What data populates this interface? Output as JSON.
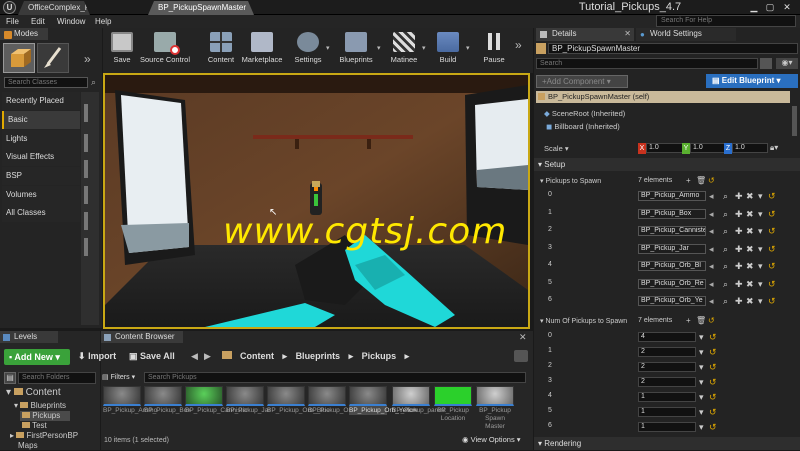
{
  "titlebar": {
    "logo": "U",
    "tabs": [
      "OfficeComplex_P",
      "BP_PickupSpawnMaster"
    ],
    "window_title": "Tutorial_Pickups_4.7"
  },
  "menu": {
    "items": [
      "File",
      "Edit",
      "Window",
      "Help"
    ],
    "help_search_placeholder": "Search For Help"
  },
  "modes": {
    "tab_label": "Modes",
    "search_placeholder": "Search Classes",
    "categories": [
      "Recently Placed",
      "Basic",
      "Lights",
      "Visual Effects",
      "BSP",
      "Volumes",
      "All Classes"
    ],
    "selected_category": "Basic"
  },
  "toolbar": {
    "buttons": [
      "Save",
      "Source Control",
      "Content",
      "Marketplace",
      "Settings",
      "Blueprints",
      "Matinee",
      "Build",
      "Pause"
    ]
  },
  "viewport": {
    "watermark": "www.cgtsj.com"
  },
  "levels": {
    "tab_label": "Levels",
    "search_placeholder": "Search Folders",
    "tree": [
      "Content",
      "Blueprints",
      "Pickups",
      "Test",
      "FirstPersonBP",
      "Maps"
    ]
  },
  "content_browser": {
    "tab_label": "Content Browser",
    "add_new_label": "Add New",
    "import_label": "Import",
    "save_all_label": "Save All",
    "breadcrumb": [
      "Content",
      "Blueprints",
      "Pickups"
    ],
    "filters_label": "Filters",
    "search_placeholder": "Search Pickups",
    "assets": [
      "BP_Pickup_Ammo",
      "BP_Pickup_Box",
      "BP_Pickup_Cannister",
      "BP_Pickup_Jar",
      "BP_Pickup_Orb_Blue",
      "BP_Pickup_Orb_Red",
      "BP_Pickup_Orb_Yellow",
      "BP_Pickup_parent",
      "BP_Pickup Location",
      "BP_Pickup Spawn Master"
    ],
    "status": "10 items (1 selected)",
    "view_options_label": "View Options"
  },
  "details": {
    "tabs": [
      "Details",
      "World Settings"
    ],
    "object_name": "BP_PickupSpawnMaster",
    "search_placeholder": "Search",
    "add_component_label": "+Add Component",
    "edit_blueprint_label": "Edit Blueprint",
    "components": [
      "BP_PickupSpawnMaster (self)",
      "SceneRoot (Inherited)",
      "Billboard (Inherited)"
    ],
    "scale_label": "Scale",
    "scale": {
      "x": "1.0",
      "y": "1.0",
      "z": "1.0"
    },
    "setup_label": "Setup",
    "pickups_to_spawn_label": "Pickups to Spawn",
    "pickups_count": "7 elements",
    "pickups": [
      "BP_Pickup_Ammo",
      "BP_Pickup_Box",
      "BP_Pickup_Cannister",
      "BP_Pickup_Jar",
      "BP_Pickup_Orb_Bl",
      "BP_Pickup_Orb_Re",
      "BP_Pickup_Orb_Ye"
    ],
    "num_pickups_label": "Num Of Pickups to Spawn",
    "num_count": "7 elements",
    "num_values": [
      "4",
      "2",
      "2",
      "2",
      "1",
      "1",
      "1"
    ],
    "indices": [
      "0",
      "1",
      "2",
      "3",
      "4",
      "5",
      "6"
    ],
    "rendering_label": "Rendering"
  },
  "colors": {
    "accent_yellow": "#e0a900",
    "edit_blueprint_blue": "#2a6fbf",
    "selected_component": "#c9b99a"
  }
}
